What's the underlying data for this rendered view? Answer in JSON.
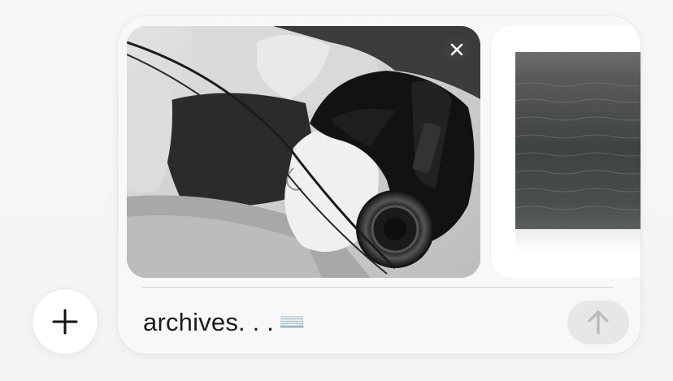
{
  "composer": {
    "input_text": "archives. . .",
    "input_emoji": "⌨️",
    "attachments": [
      {
        "kind": "photo",
        "icon": "close-icon"
      },
      {
        "kind": "photo",
        "icon": ""
      }
    ],
    "send_icon": "arrow-up-icon"
  },
  "plus_button": {
    "icon": "plus-icon"
  },
  "colors": {
    "card_background": "#f8f8f9",
    "send_button_disabled": "#e7e7e9",
    "send_arrow_disabled": "#b9b9be",
    "text": "#1b1b1f"
  }
}
